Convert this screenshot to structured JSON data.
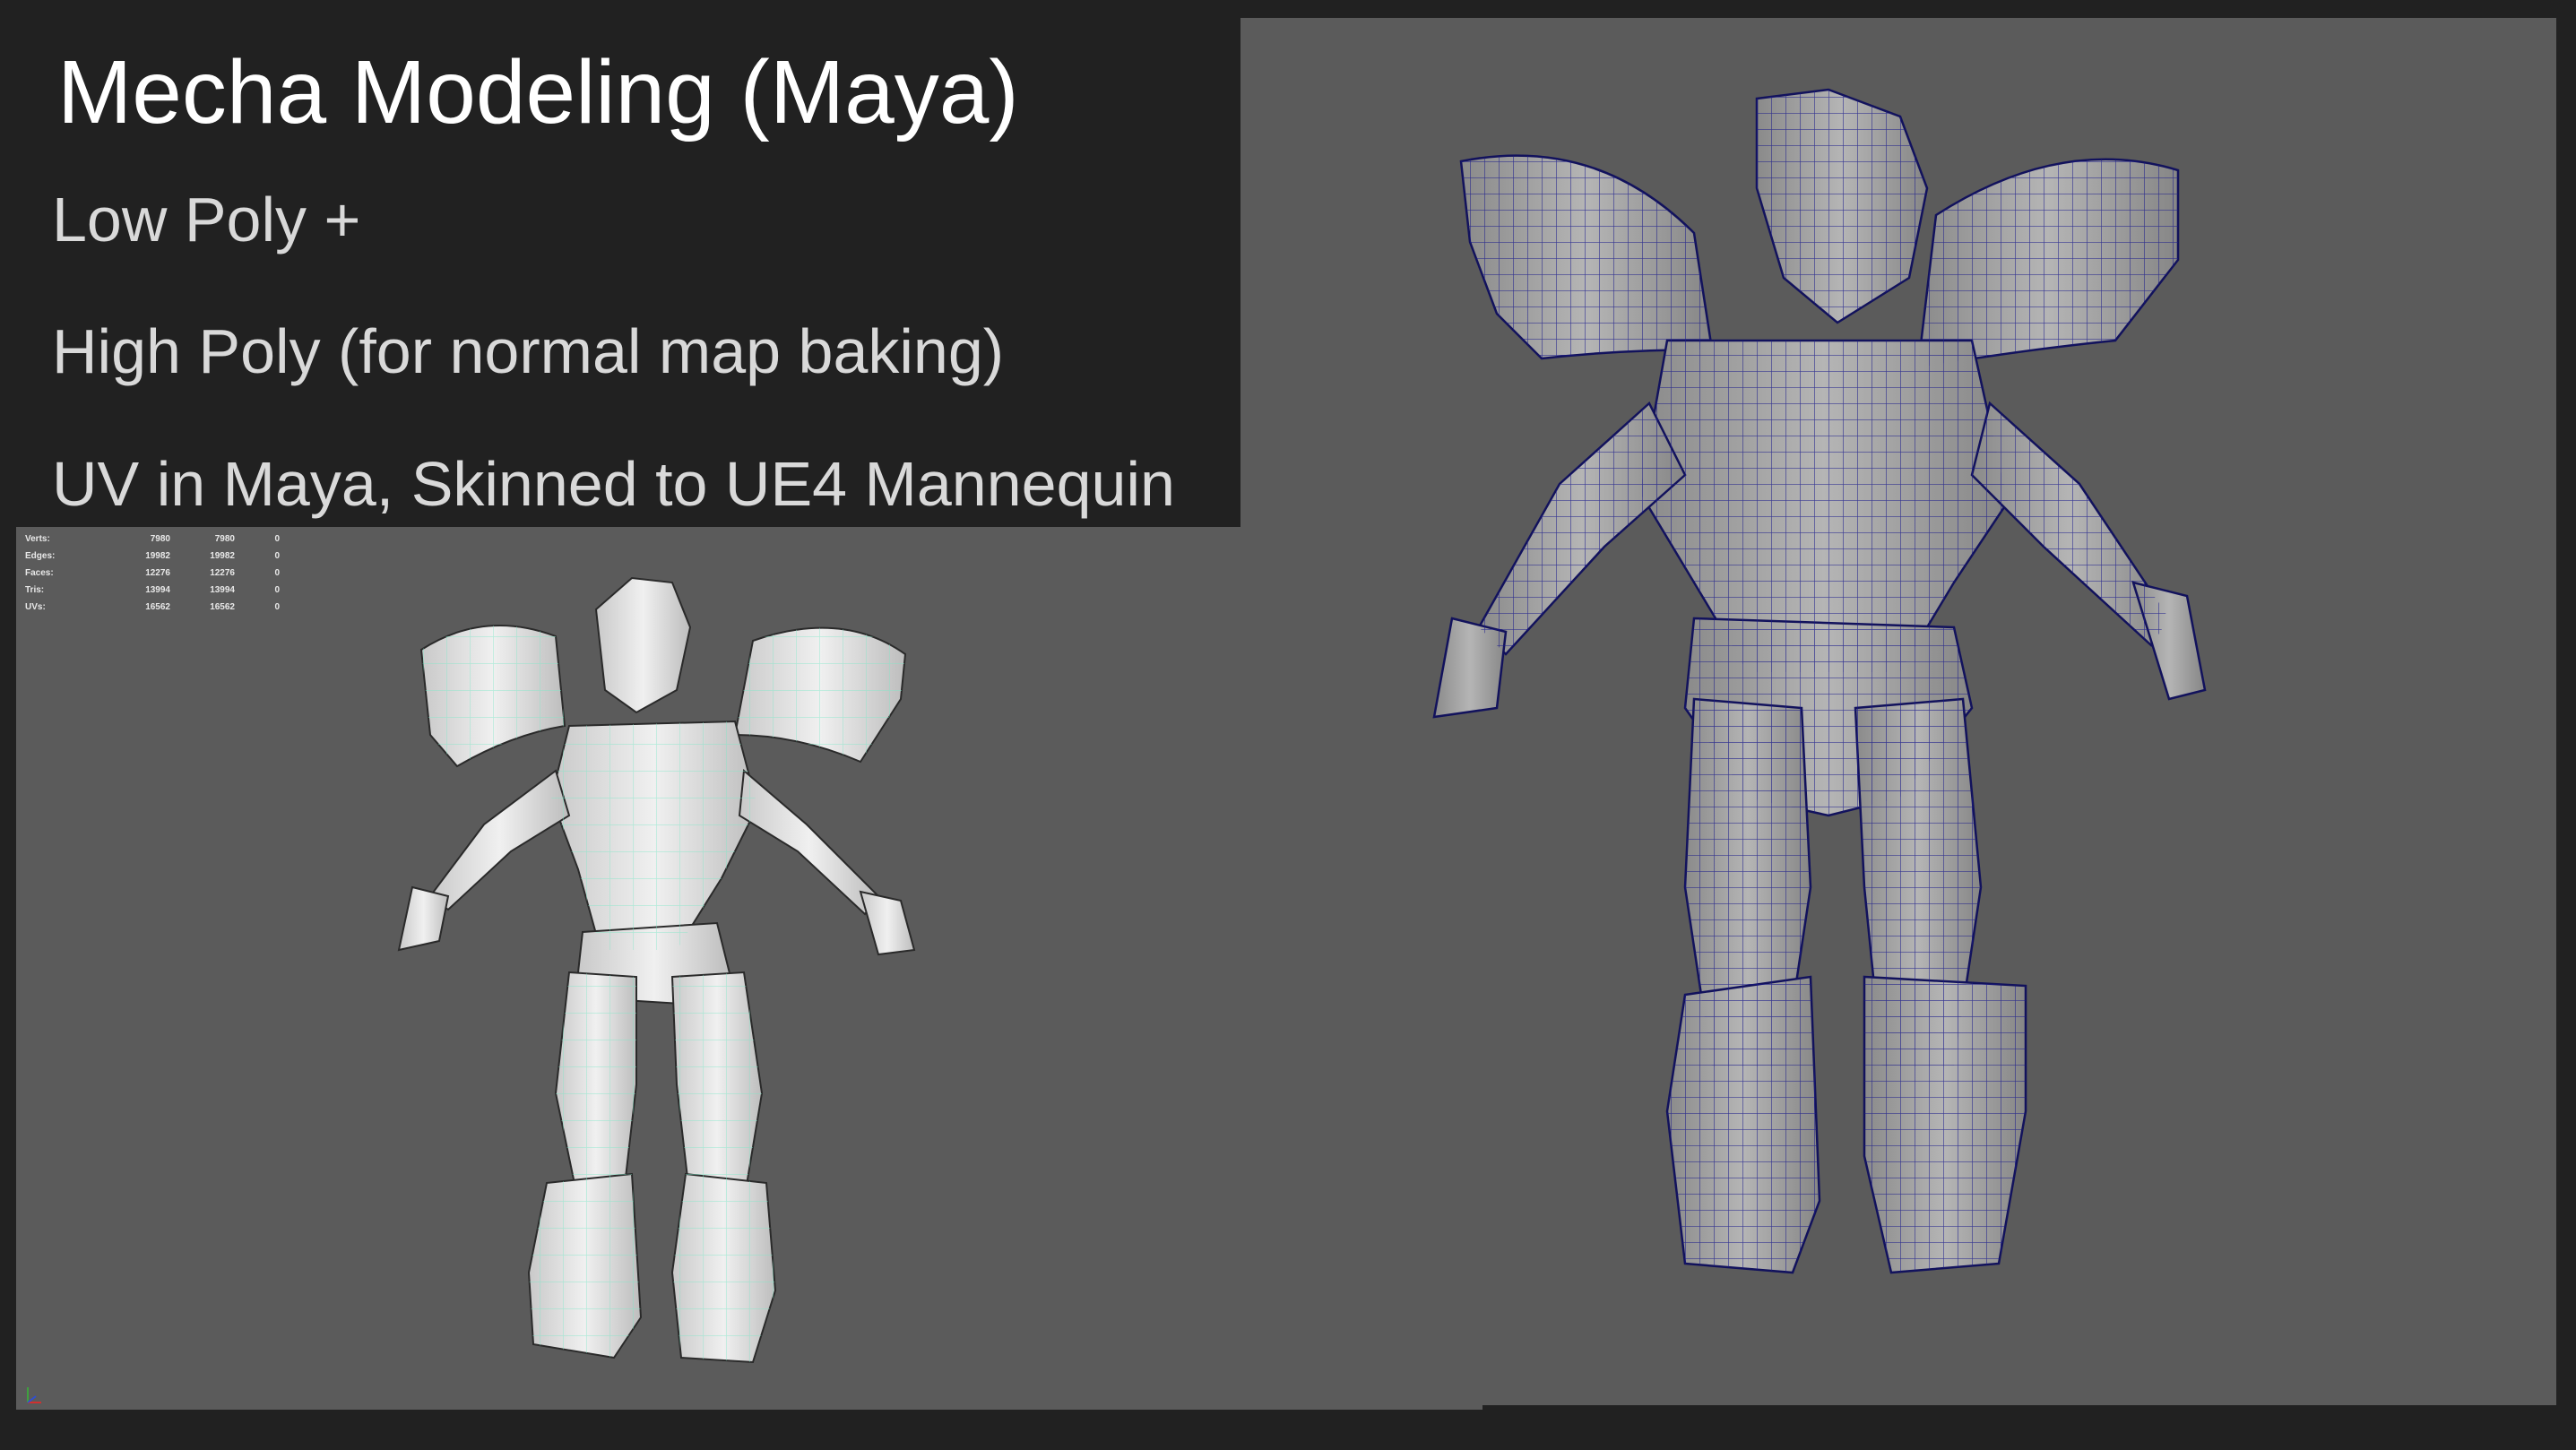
{
  "slide": {
    "title": "Mecha Modeling (Maya)",
    "bullets": [
      "Low Poly +",
      "High Poly (for normal map baking)",
      "UV in Maya, Skinned to UE4 Mannequin"
    ]
  },
  "hud": {
    "rows": [
      {
        "label": "Verts:",
        "a": "7980",
        "b": "7980",
        "c": "0"
      },
      {
        "label": "Edges:",
        "a": "19982",
        "b": "19982",
        "c": "0"
      },
      {
        "label": "Faces:",
        "a": "12276",
        "b": "12276",
        "c": "0"
      },
      {
        "label": "Tris:",
        "a": "13994",
        "b": "13994",
        "c": "0"
      },
      {
        "label": "UVs:",
        "a": "16562",
        "b": "16562",
        "c": "0"
      }
    ]
  },
  "colors": {
    "background": "#212121",
    "viewport": "#5b5b5b",
    "low_poly_wire": "#7fe8c8",
    "high_poly_wire": "#1a1a8c"
  }
}
